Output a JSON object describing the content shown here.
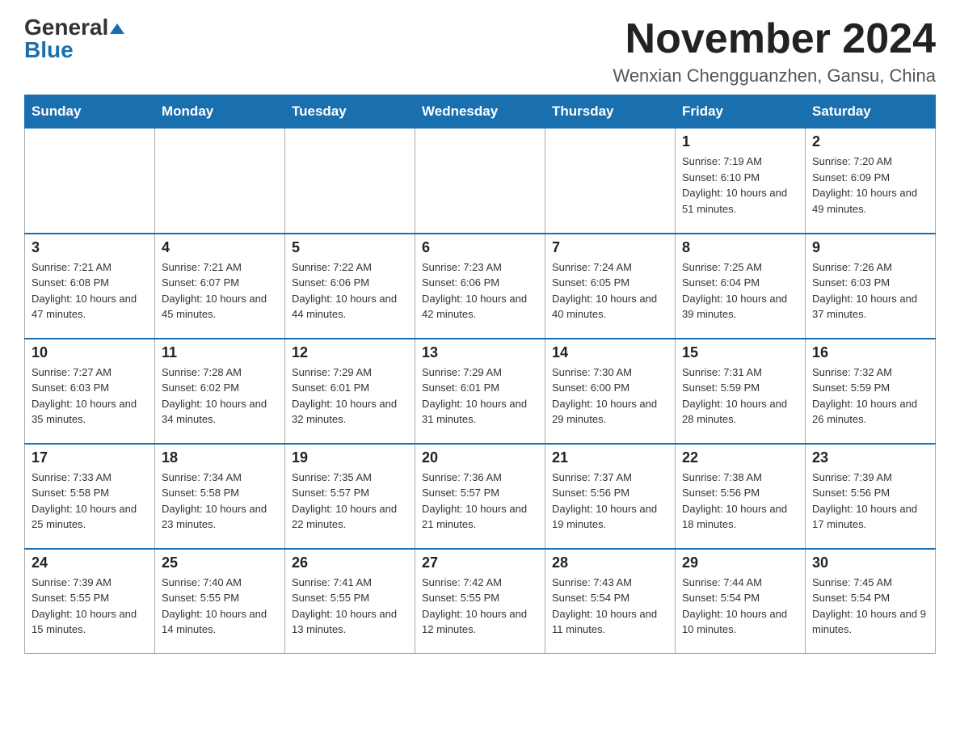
{
  "header": {
    "logo_main": "General",
    "logo_sub": "Blue",
    "month_title": "November 2024",
    "location": "Wenxian Chengguanzhen, Gansu, China"
  },
  "days_of_week": [
    "Sunday",
    "Monday",
    "Tuesday",
    "Wednesday",
    "Thursday",
    "Friday",
    "Saturday"
  ],
  "weeks": [
    [
      {
        "day": "",
        "info": ""
      },
      {
        "day": "",
        "info": ""
      },
      {
        "day": "",
        "info": ""
      },
      {
        "day": "",
        "info": ""
      },
      {
        "day": "",
        "info": ""
      },
      {
        "day": "1",
        "info": "Sunrise: 7:19 AM\nSunset: 6:10 PM\nDaylight: 10 hours and 51 minutes."
      },
      {
        "day": "2",
        "info": "Sunrise: 7:20 AM\nSunset: 6:09 PM\nDaylight: 10 hours and 49 minutes."
      }
    ],
    [
      {
        "day": "3",
        "info": "Sunrise: 7:21 AM\nSunset: 6:08 PM\nDaylight: 10 hours and 47 minutes."
      },
      {
        "day": "4",
        "info": "Sunrise: 7:21 AM\nSunset: 6:07 PM\nDaylight: 10 hours and 45 minutes."
      },
      {
        "day": "5",
        "info": "Sunrise: 7:22 AM\nSunset: 6:06 PM\nDaylight: 10 hours and 44 minutes."
      },
      {
        "day": "6",
        "info": "Sunrise: 7:23 AM\nSunset: 6:06 PM\nDaylight: 10 hours and 42 minutes."
      },
      {
        "day": "7",
        "info": "Sunrise: 7:24 AM\nSunset: 6:05 PM\nDaylight: 10 hours and 40 minutes."
      },
      {
        "day": "8",
        "info": "Sunrise: 7:25 AM\nSunset: 6:04 PM\nDaylight: 10 hours and 39 minutes."
      },
      {
        "day": "9",
        "info": "Sunrise: 7:26 AM\nSunset: 6:03 PM\nDaylight: 10 hours and 37 minutes."
      }
    ],
    [
      {
        "day": "10",
        "info": "Sunrise: 7:27 AM\nSunset: 6:03 PM\nDaylight: 10 hours and 35 minutes."
      },
      {
        "day": "11",
        "info": "Sunrise: 7:28 AM\nSunset: 6:02 PM\nDaylight: 10 hours and 34 minutes."
      },
      {
        "day": "12",
        "info": "Sunrise: 7:29 AM\nSunset: 6:01 PM\nDaylight: 10 hours and 32 minutes."
      },
      {
        "day": "13",
        "info": "Sunrise: 7:29 AM\nSunset: 6:01 PM\nDaylight: 10 hours and 31 minutes."
      },
      {
        "day": "14",
        "info": "Sunrise: 7:30 AM\nSunset: 6:00 PM\nDaylight: 10 hours and 29 minutes."
      },
      {
        "day": "15",
        "info": "Sunrise: 7:31 AM\nSunset: 5:59 PM\nDaylight: 10 hours and 28 minutes."
      },
      {
        "day": "16",
        "info": "Sunrise: 7:32 AM\nSunset: 5:59 PM\nDaylight: 10 hours and 26 minutes."
      }
    ],
    [
      {
        "day": "17",
        "info": "Sunrise: 7:33 AM\nSunset: 5:58 PM\nDaylight: 10 hours and 25 minutes."
      },
      {
        "day": "18",
        "info": "Sunrise: 7:34 AM\nSunset: 5:58 PM\nDaylight: 10 hours and 23 minutes."
      },
      {
        "day": "19",
        "info": "Sunrise: 7:35 AM\nSunset: 5:57 PM\nDaylight: 10 hours and 22 minutes."
      },
      {
        "day": "20",
        "info": "Sunrise: 7:36 AM\nSunset: 5:57 PM\nDaylight: 10 hours and 21 minutes."
      },
      {
        "day": "21",
        "info": "Sunrise: 7:37 AM\nSunset: 5:56 PM\nDaylight: 10 hours and 19 minutes."
      },
      {
        "day": "22",
        "info": "Sunrise: 7:38 AM\nSunset: 5:56 PM\nDaylight: 10 hours and 18 minutes."
      },
      {
        "day": "23",
        "info": "Sunrise: 7:39 AM\nSunset: 5:56 PM\nDaylight: 10 hours and 17 minutes."
      }
    ],
    [
      {
        "day": "24",
        "info": "Sunrise: 7:39 AM\nSunset: 5:55 PM\nDaylight: 10 hours and 15 minutes."
      },
      {
        "day": "25",
        "info": "Sunrise: 7:40 AM\nSunset: 5:55 PM\nDaylight: 10 hours and 14 minutes."
      },
      {
        "day": "26",
        "info": "Sunrise: 7:41 AM\nSunset: 5:55 PM\nDaylight: 10 hours and 13 minutes."
      },
      {
        "day": "27",
        "info": "Sunrise: 7:42 AM\nSunset: 5:55 PM\nDaylight: 10 hours and 12 minutes."
      },
      {
        "day": "28",
        "info": "Sunrise: 7:43 AM\nSunset: 5:54 PM\nDaylight: 10 hours and 11 minutes."
      },
      {
        "day": "29",
        "info": "Sunrise: 7:44 AM\nSunset: 5:54 PM\nDaylight: 10 hours and 10 minutes."
      },
      {
        "day": "30",
        "info": "Sunrise: 7:45 AM\nSunset: 5:54 PM\nDaylight: 10 hours and 9 minutes."
      }
    ]
  ]
}
